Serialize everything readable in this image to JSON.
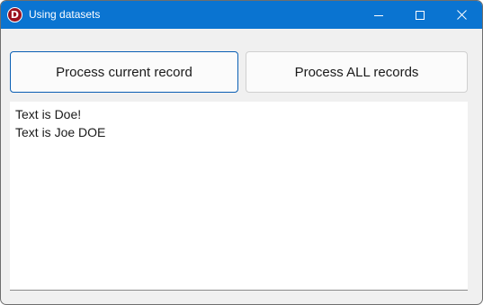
{
  "window": {
    "title": "Using datasets",
    "app_icon_letter": "D",
    "accent": "#0a74d1"
  },
  "controls": {
    "minimize_icon": "minimize-icon",
    "maximize_icon": "maximize-icon",
    "close_icon": "close-icon"
  },
  "buttons": {
    "process_current": "Process current record",
    "process_all": "Process ALL records"
  },
  "memo": {
    "lines": [
      "Text is Doe!",
      "Text is Joe DOE"
    ]
  }
}
